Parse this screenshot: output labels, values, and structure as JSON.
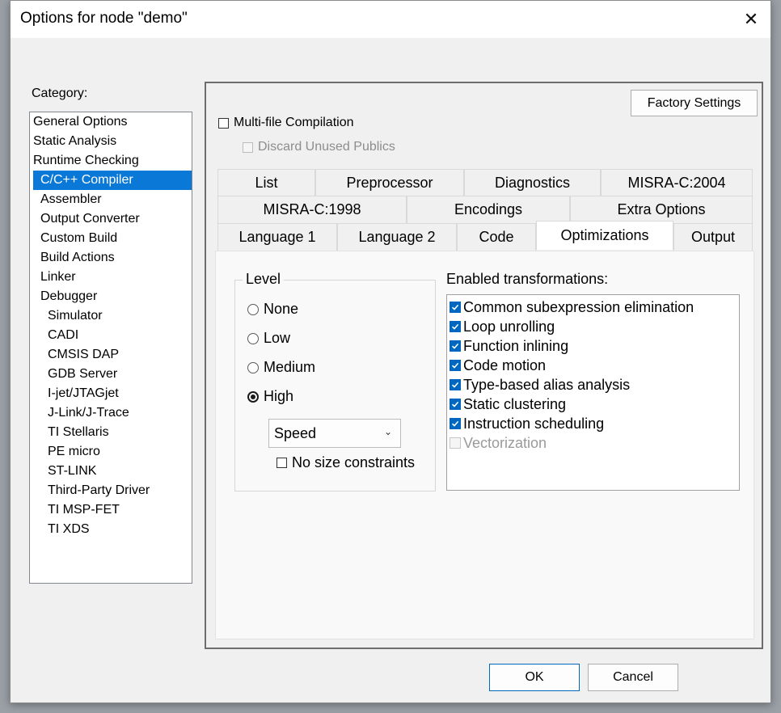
{
  "window": {
    "title": "Options for node \"demo\"",
    "close_glyph": "✕"
  },
  "category": {
    "label": "Category:",
    "items": [
      {
        "label": "General Options",
        "level": 0
      },
      {
        "label": "Static Analysis",
        "level": 0
      },
      {
        "label": "Runtime Checking",
        "level": 0
      },
      {
        "label": "C/C++ Compiler",
        "level": 1,
        "selected": true
      },
      {
        "label": "Assembler",
        "level": 1
      },
      {
        "label": "Output Converter",
        "level": 1
      },
      {
        "label": "Custom Build",
        "level": 1
      },
      {
        "label": "Build Actions",
        "level": 1
      },
      {
        "label": "Linker",
        "level": 1
      },
      {
        "label": "Debugger",
        "level": 1
      },
      {
        "label": "Simulator",
        "level": 2
      },
      {
        "label": "CADI",
        "level": 2
      },
      {
        "label": "CMSIS DAP",
        "level": 2
      },
      {
        "label": "GDB Server",
        "level": 2
      },
      {
        "label": "I-jet/JTAGjet",
        "level": 2
      },
      {
        "label": "J-Link/J-Trace",
        "level": 2
      },
      {
        "label": "TI Stellaris",
        "level": 2
      },
      {
        "label": "PE micro",
        "level": 2
      },
      {
        "label": "ST-LINK",
        "level": 2
      },
      {
        "label": "Third-Party Driver",
        "level": 2
      },
      {
        "label": "TI MSP-FET",
        "level": 2
      },
      {
        "label": "TI XDS",
        "level": 2
      }
    ]
  },
  "panel": {
    "factory_settings": "Factory Settings",
    "multifile": "Multi-file Compilation",
    "discard": "Discard Unused Publics",
    "tabs_row1": [
      "List",
      "Preprocessor",
      "Diagnostics",
      "MISRA-C:2004"
    ],
    "tabs_row2": [
      "MISRA-C:1998",
      "Encodings",
      "Extra Options"
    ],
    "tabs_row3": [
      "Language 1",
      "Language 2",
      "Code",
      "Optimizations",
      "Output"
    ],
    "active_tab": "Optimizations",
    "level": {
      "title": "Level",
      "options": [
        "None",
        "Low",
        "Medium",
        "High"
      ],
      "selected": "High",
      "goal": "Speed",
      "no_size": "No size constraints"
    },
    "transformations": {
      "title": "Enabled transformations:",
      "items": [
        {
          "label": "Common subexpression elimination",
          "checked": true,
          "enabled": true
        },
        {
          "label": "Loop unrolling",
          "checked": true,
          "enabled": true
        },
        {
          "label": "Function inlining",
          "checked": true,
          "enabled": true
        },
        {
          "label": "Code motion",
          "checked": true,
          "enabled": true
        },
        {
          "label": "Type-based alias analysis",
          "checked": true,
          "enabled": true
        },
        {
          "label": "Static clustering",
          "checked": true,
          "enabled": true
        },
        {
          "label": "Instruction scheduling",
          "checked": true,
          "enabled": true
        },
        {
          "label": "Vectorization",
          "checked": false,
          "enabled": false
        }
      ]
    }
  },
  "buttons": {
    "ok": "OK",
    "cancel": "Cancel"
  },
  "colors": {
    "selection": "#0a78d7",
    "check_accent": "#0067c0"
  }
}
